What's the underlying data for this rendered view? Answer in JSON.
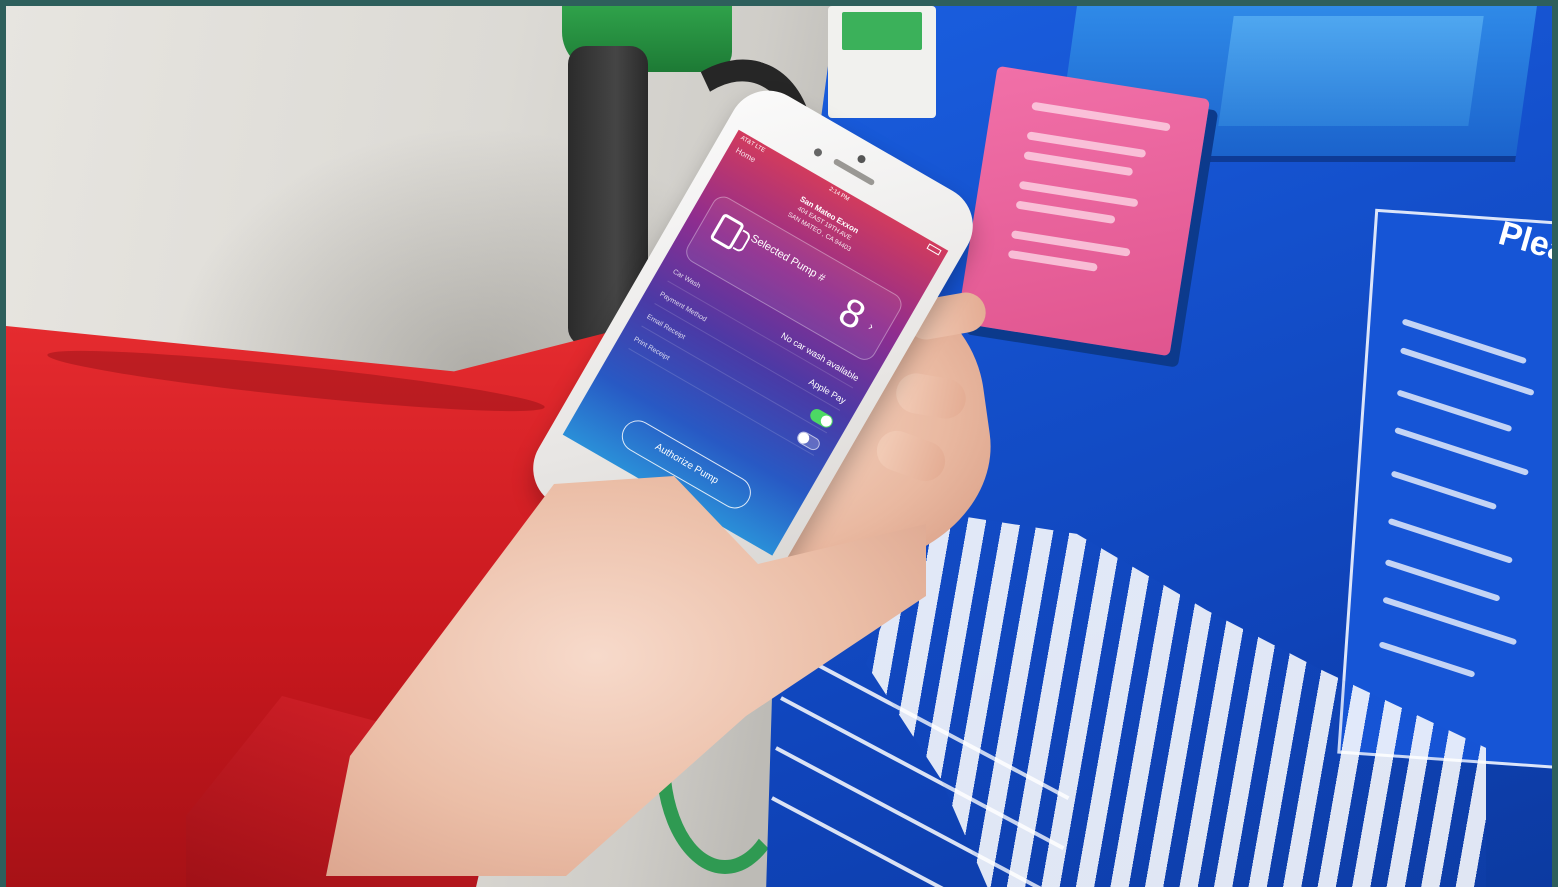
{
  "photo": {
    "subject": "",
    "accent_colors": {
      "jacket_red": "#d4222a",
      "pump_blue": "#1553d2",
      "sign_pink": "#ea5f9a",
      "nozzle_green": "#2a9a48"
    }
  },
  "pump_sign": {
    "title": "Please Pay First"
  },
  "phone_screen": {
    "status": {
      "carrier": "AT&T LTE",
      "time": "2:14 PM"
    },
    "nav_back": "Home",
    "station": {
      "name": "San Mateo Exxon",
      "address_line1": "404 EAST 19TH AVE",
      "address_line2": "SAN MATEO , CA 94403"
    },
    "pump_selector": {
      "label": "Selected Pump #",
      "number": "8",
      "chevron": "›"
    },
    "options": [
      {
        "label": "Car Wash",
        "value": "No car wash available"
      },
      {
        "label": "Payment Method",
        "value": "Apple Pay"
      },
      {
        "label": "Email Receipt",
        "toggle": true
      },
      {
        "label": "Print Receipt",
        "toggle": false
      }
    ],
    "authorize_button": "Authorize Pump"
  }
}
